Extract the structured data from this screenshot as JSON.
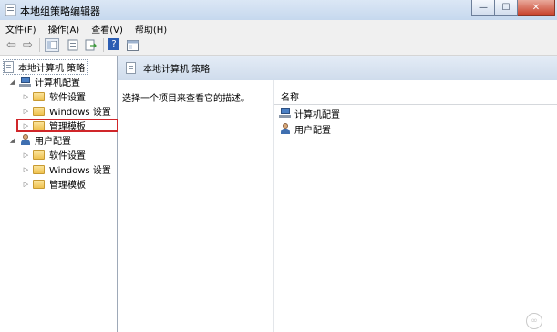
{
  "window": {
    "title": "本地组策略编辑器",
    "minimize": "—",
    "maximize": "☐",
    "close": "✕"
  },
  "menu": [
    "文件(F)",
    "操作(A)",
    "查看(V)",
    "帮助(H)"
  ],
  "toolbar": {
    "back": "⇦",
    "forward": "⇨",
    "help": "?"
  },
  "tree": {
    "root": "本地计算机 策略",
    "computer_config": {
      "label": "计算机配置",
      "children": [
        "软件设置",
        "Windows 设置",
        "管理模板"
      ]
    },
    "user_config": {
      "label": "用户配置",
      "children": [
        "软件设置",
        "Windows 设置",
        "管理模板"
      ]
    },
    "expand_glyph": "▷",
    "collapse_glyph": "◢"
  },
  "details": {
    "header": "本地计算机 策略",
    "description": "选择一个项目来查看它的描述。",
    "column_name": "名称",
    "items": [
      "计算机配置",
      "用户配置"
    ]
  },
  "highlight_color": "#d0262a",
  "watermark": "∞"
}
